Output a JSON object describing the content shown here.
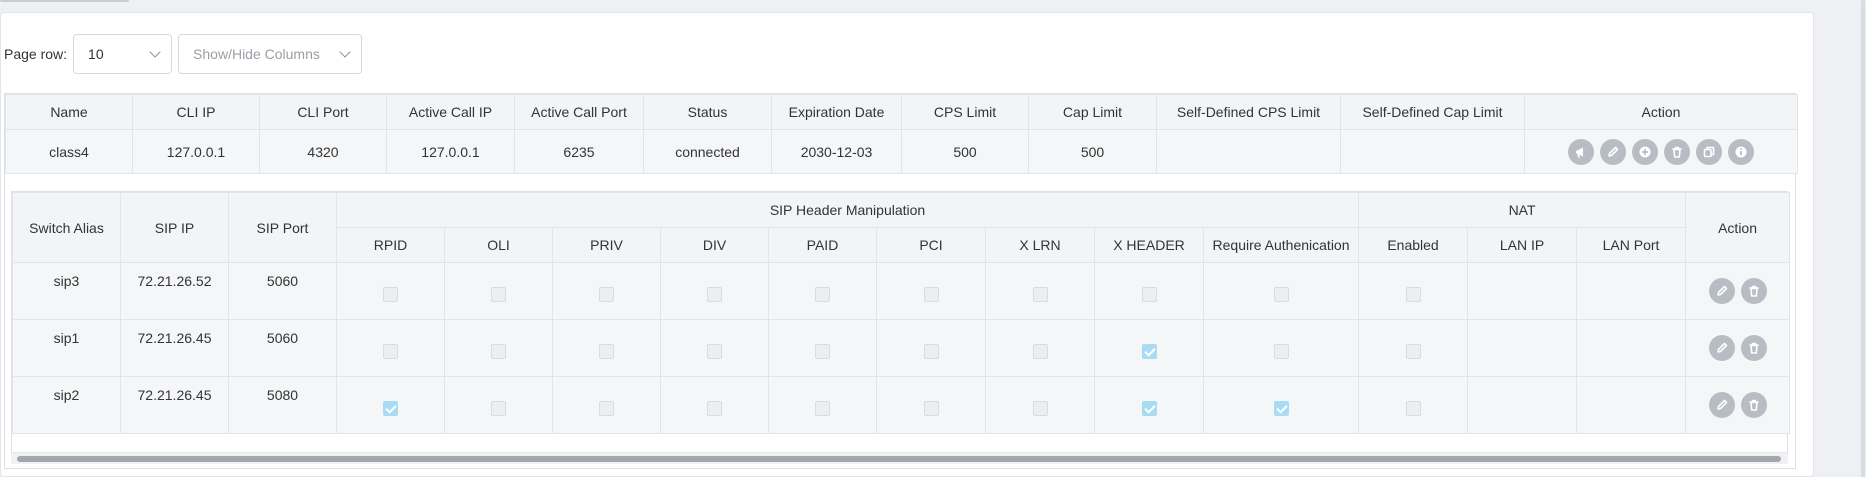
{
  "toolbar": {
    "page_row_label": "Page row:",
    "page_row_value": "10",
    "columns_placeholder": "Show/Hide Columns"
  },
  "main_table": {
    "headers": [
      "Name",
      "CLI IP",
      "CLI Port",
      "Active Call IP",
      "Active Call Port",
      "Status",
      "Expiration Date",
      "CPS Limit",
      "Cap Limit",
      "Self-Defined CPS Limit",
      "Self-Defined Cap Limit",
      "Action"
    ],
    "row": [
      "class4",
      "127.0.0.1",
      "4320",
      "127.0.0.1",
      "6235",
      "connected",
      "2030-12-03",
      "500",
      "500",
      "",
      ""
    ],
    "actions": [
      "megaphone-icon",
      "pencil-icon",
      "plus-circle-icon",
      "trash-icon",
      "copy-icon",
      "info-icon"
    ]
  },
  "switch_table": {
    "header": {
      "switch_alias": "Switch Alias",
      "sip_ip": "SIP IP",
      "sip_port": "SIP Port",
      "sip_header_manipulation": "SIP Header Manipulation",
      "nat": "NAT",
      "action": "Action",
      "sip_cols": [
        "RPID",
        "OLI",
        "PRIV",
        "DIV",
        "PAID",
        "PCI",
        "X LRN",
        "X HEADER",
        "Require Authenication"
      ],
      "nat_cols": [
        "Enabled",
        "LAN IP",
        "LAN Port"
      ]
    },
    "rows": [
      {
        "alias": "sip3",
        "ip": "72.21.26.52",
        "port": "5060",
        "checks": [
          false,
          false,
          false,
          false,
          false,
          false,
          false,
          false,
          false
        ],
        "nat_enabled": false,
        "lan_ip": "",
        "lan_port": ""
      },
      {
        "alias": "sip1",
        "ip": "72.21.26.45",
        "port": "5060",
        "checks": [
          false,
          false,
          false,
          false,
          false,
          false,
          false,
          true,
          false
        ],
        "nat_enabled": false,
        "lan_ip": "",
        "lan_port": ""
      },
      {
        "alias": "sip2",
        "ip": "72.21.26.45",
        "port": "5080",
        "checks": [
          true,
          false,
          false,
          false,
          false,
          false,
          false,
          true,
          true
        ],
        "nat_enabled": false,
        "lan_ip": "",
        "lan_port": ""
      }
    ],
    "row_actions": [
      "pencil-icon",
      "trash-icon"
    ]
  },
  "colors": {
    "checked": "#a9dcf3",
    "action_button": "#b8bdc4",
    "header_bg": "#f2f4f7"
  }
}
